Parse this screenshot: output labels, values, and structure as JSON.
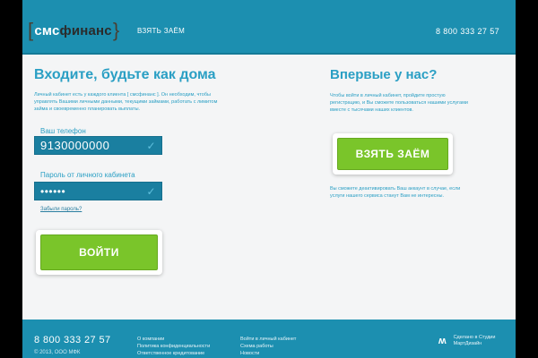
{
  "header": {
    "logo": {
      "bracket_open": "[",
      "part1": "смс",
      "part2": "финанс",
      "bracket_close": "}"
    },
    "nav_loan": "ВЗЯТЬ ЗАЁМ",
    "phone": "8 800 333 27 57"
  },
  "login": {
    "title": "Входите, будьте как дома",
    "description": "Личный кабинет есть у каждого клиента [ смсфинанс ]. Он необходим, чтобы управлять Вашими личными данными, текущими займами, работать с лимитом займа и своевременно планировать выплаты.",
    "phone_label": "Ваш телефон",
    "phone_value": "9130000000",
    "password_label": "Пароль от личного кабинета",
    "password_value": "••••••",
    "forgot": "Забыли пароль?",
    "submit": "ВОЙТИ"
  },
  "newcomer": {
    "title": "Впервые у нас?",
    "description": "Чтобы войти в личный кабинет, пройдите простую регистрацию, и Вы сможете пользоваться нашими услугами вместе с тысячами наших клиентов.",
    "cta": "ВЗЯТЬ ЗАЁМ",
    "note": "Вы сможете деактивировать Ваш аккаунт в случае, если услуги нашего сервиса станут Вам не интересны."
  },
  "footer": {
    "phone": "8 800 333 27 57",
    "copyright": "© 2013, ООО МФК",
    "col1": [
      "О компании",
      "Политика конфиденциальности",
      "Ответственное кредитование"
    ],
    "col2": [
      "Войти в личный кабинет",
      "Схема работы",
      "Новости"
    ],
    "studio_icon": "studio-logo-icon",
    "studio_line1": "Сделано в Студии",
    "studio_line2": "МартДизайн"
  },
  "colors": {
    "brand_blue": "#1c8fb0",
    "text_blue": "#2a9fc4",
    "accent_green": "#7ac52a",
    "background": "#f4f5f6"
  }
}
